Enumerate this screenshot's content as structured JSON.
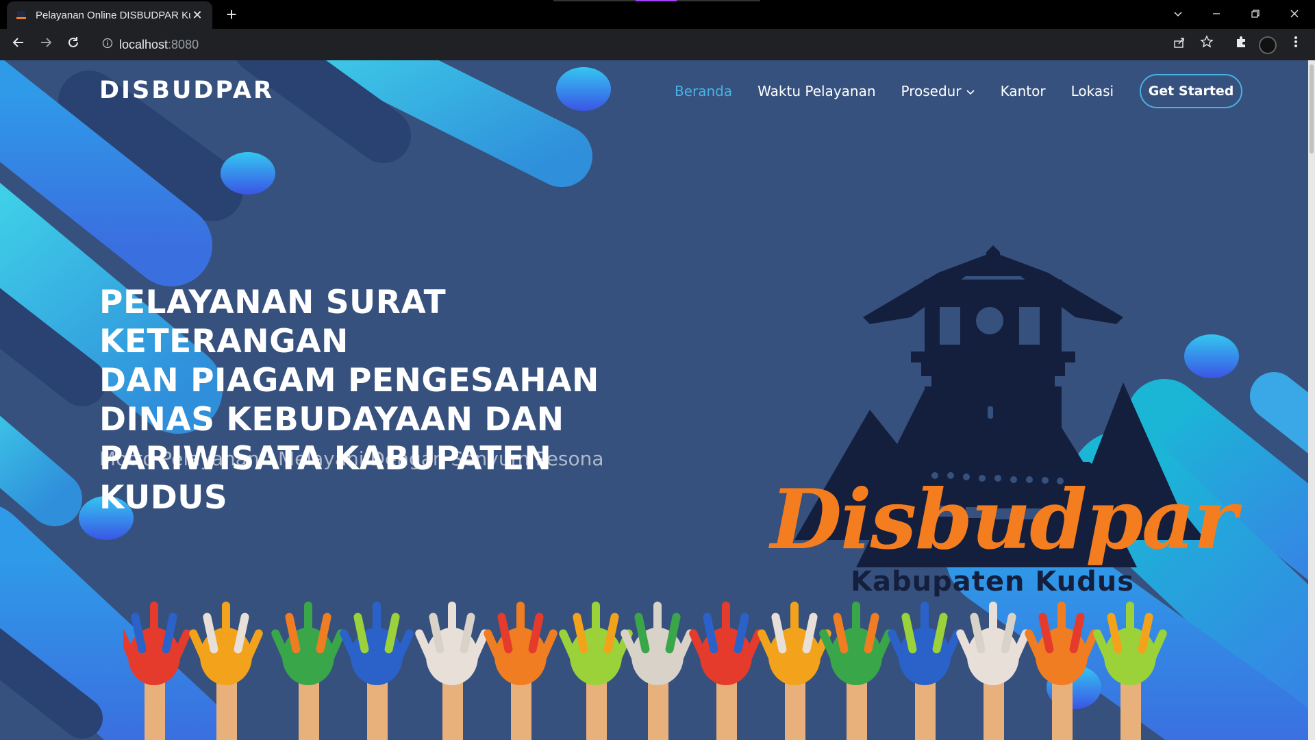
{
  "browser": {
    "tab_title": "Pelayanan Online DISBUDPAR Ku",
    "tab_close": "✕",
    "new_tab": "+",
    "url_host": "localhost",
    "url_port": ":8080"
  },
  "site": {
    "brand": "DISBUDPAR",
    "nav": {
      "home": "Beranda",
      "hours": "Waktu Pelayanan",
      "procedure": "Prosedur",
      "office": "Kantor",
      "location": "Lokasi",
      "cta": "Get Started"
    },
    "hero": {
      "line1": "PELAYANAN SURAT KETERANGAN",
      "line2": "DAN PIAGAM PENGESAHAN",
      "line3": "DINAS KEBUDAYAAN DAN",
      "line4": "PARIWISATA KABUPATEN KUDUS",
      "motto": "Motto Pelayanan : Melayani Dengan Senyum Pesona"
    },
    "logo": {
      "script_text": "Disbudpar",
      "subtitle": "Kabupaten Kudus"
    }
  },
  "colors": {
    "page_bg": "#37517e",
    "accent": "#47b2e4",
    "logo_orange": "#f47d20",
    "logo_navy": "#141f3d"
  },
  "icons": [
    "back-arrow-icon",
    "forward-arrow-icon",
    "reload-icon",
    "info-icon",
    "share-icon",
    "star-icon",
    "extensions-icon",
    "menu-dots-icon",
    "chevron-down-icon",
    "minimize-icon",
    "restore-icon",
    "close-icon"
  ]
}
